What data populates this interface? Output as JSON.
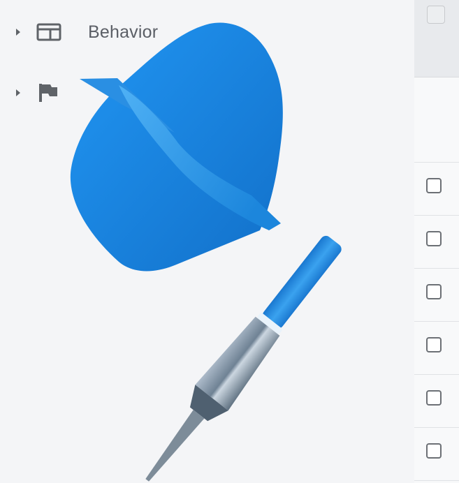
{
  "tree": {
    "items": [
      {
        "label": "Behavior",
        "icon": "layout-panel-icon"
      },
      {
        "label": "",
        "icon": "flag-icon"
      }
    ]
  },
  "checkboxes": {
    "header_checked": false,
    "rows_checked": [
      false,
      false,
      false,
      false,
      false
    ]
  },
  "colors": {
    "dart_flight": "#1e88e5",
    "dart_barrel": "#8fa3b5",
    "text": "#5b5f66"
  }
}
